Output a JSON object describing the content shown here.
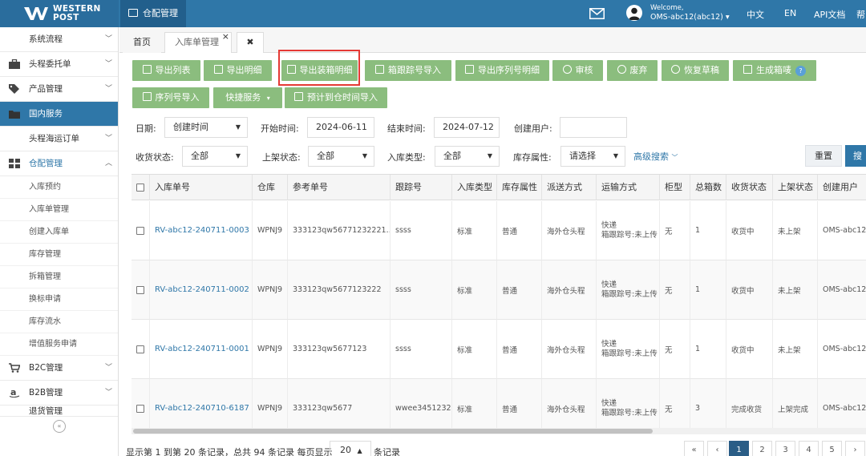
{
  "header": {
    "logo_line1": "WESTERN",
    "logo_line2": "POST",
    "module_tab": "仓配管理",
    "welcome": "Welcome,",
    "user": "OMS-abc12(abc12)",
    "lang_cn": "中文",
    "lang_en": "EN",
    "api_docs": "API文档",
    "help": "帮"
  },
  "sidebar": {
    "items": [
      {
        "label": "系统流程"
      },
      {
        "label": "头程委托单"
      },
      {
        "label": "产品管理"
      },
      {
        "label": "国内服务"
      },
      {
        "label": "头程海运订单"
      },
      {
        "label": "仓配管理"
      }
    ],
    "sub_items": [
      {
        "label": "入库预约"
      },
      {
        "label": "入库单管理"
      },
      {
        "label": "创建入库单"
      },
      {
        "label": "库存管理"
      },
      {
        "label": "拆箱管理"
      },
      {
        "label": "换标申请"
      },
      {
        "label": "库存流水"
      },
      {
        "label": "增值服务申请"
      }
    ],
    "bottom_items": [
      {
        "label": "B2C管理"
      },
      {
        "label": "B2B管理"
      },
      {
        "label": "退货管理"
      }
    ],
    "collapse": "«"
  },
  "tabs": {
    "home": "首页",
    "current": "入库单管理",
    "close": "×",
    "close_all": "✖"
  },
  "toolbar": {
    "row1": [
      "导出列表",
      "导出明细",
      "导出装箱明细",
      "箱跟踪号导入",
      "导出序列号明细",
      "审核",
      "废弃",
      "恢复草稿",
      "生成箱唛"
    ],
    "row2": [
      "序列号导入",
      "快捷服务",
      "预计到仓时间导入"
    ],
    "help_badge": "?"
  },
  "filters": {
    "date_label": "日期:",
    "date_value": "创建时间",
    "start_label": "开始时间:",
    "start_value": "2024-06-11",
    "end_label": "结束时间:",
    "end_value": "2024-07-12",
    "creator_label": "创建用户:",
    "creator_value": "",
    "receive_label": "收货状态:",
    "receive_value": "全部",
    "shelf_label": "上架状态:",
    "shelf_value": "全部",
    "type_label": "入库类型:",
    "type_value": "全部",
    "attr_label": "库存属性:",
    "attr_value": "请选择",
    "advanced": "高级搜索",
    "reset": "重置",
    "search": "搜"
  },
  "table": {
    "columns": [
      "入库单号",
      "仓库",
      "参考单号",
      "跟踪号",
      "入库类型",
      "库存属性",
      "派送方式",
      "运输方式",
      "柜型",
      "总箱数",
      "收货状态",
      "上架状态",
      "创建用户"
    ],
    "rows": [
      {
        "no": "RV-abc12-240711-0003",
        "wh": "WPNJ9",
        "ref": "333123qw56771232221…",
        "track": "ssss",
        "type": "标准",
        "attr": "普通",
        "deliver": "海外仓头程",
        "ship1": "快递",
        "ship2": "箱跟踪号:未上传",
        "cab": "无",
        "boxes": "1",
        "recv": "收货中",
        "shelf": "未上架",
        "user": "OMS-abc12"
      },
      {
        "no": "RV-abc12-240711-0002",
        "wh": "WPNJ9",
        "ref": "333123qw5677123222",
        "track": "ssss",
        "type": "标准",
        "attr": "普通",
        "deliver": "海外仓头程",
        "ship1": "快递",
        "ship2": "箱跟踪号:未上传",
        "cab": "无",
        "boxes": "1",
        "recv": "收货中",
        "shelf": "未上架",
        "user": "OMS-abc12"
      },
      {
        "no": "RV-abc12-240711-0001",
        "wh": "WPNJ9",
        "ref": "333123qw5677123",
        "track": "ssss",
        "type": "标准",
        "attr": "普通",
        "deliver": "海外仓头程",
        "ship1": "快递",
        "ship2": "箱跟踪号:未上传",
        "cab": "无",
        "boxes": "1",
        "recv": "收货中",
        "shelf": "未上架",
        "user": "OMS-abc12"
      },
      {
        "no": "RV-abc12-240710-6187",
        "wh": "WPNJ9",
        "ref": "333123qw5677",
        "track": "wwee3451232",
        "type": "标准",
        "attr": "普通",
        "deliver": "海外仓头程",
        "ship1": "快递",
        "ship2": "箱跟踪号:未上传",
        "cab": "无",
        "boxes": "3",
        "recv": "完成收货",
        "shelf": "上架完成",
        "user": "OMS-abc12"
      }
    ]
  },
  "pagination": {
    "info": "显示第 1 到第 20 条记录，总共 94 条记录 每页显示",
    "page_size": "20",
    "after": "条记录",
    "first": "«",
    "prev": "‹",
    "pages": [
      "1",
      "2",
      "3",
      "4",
      "5"
    ],
    "next": "›"
  },
  "colors": {
    "header": "#2f77a8",
    "button_green": "#8bbd7e",
    "highlight_red": "#e53935",
    "link": "#2f77a8"
  }
}
